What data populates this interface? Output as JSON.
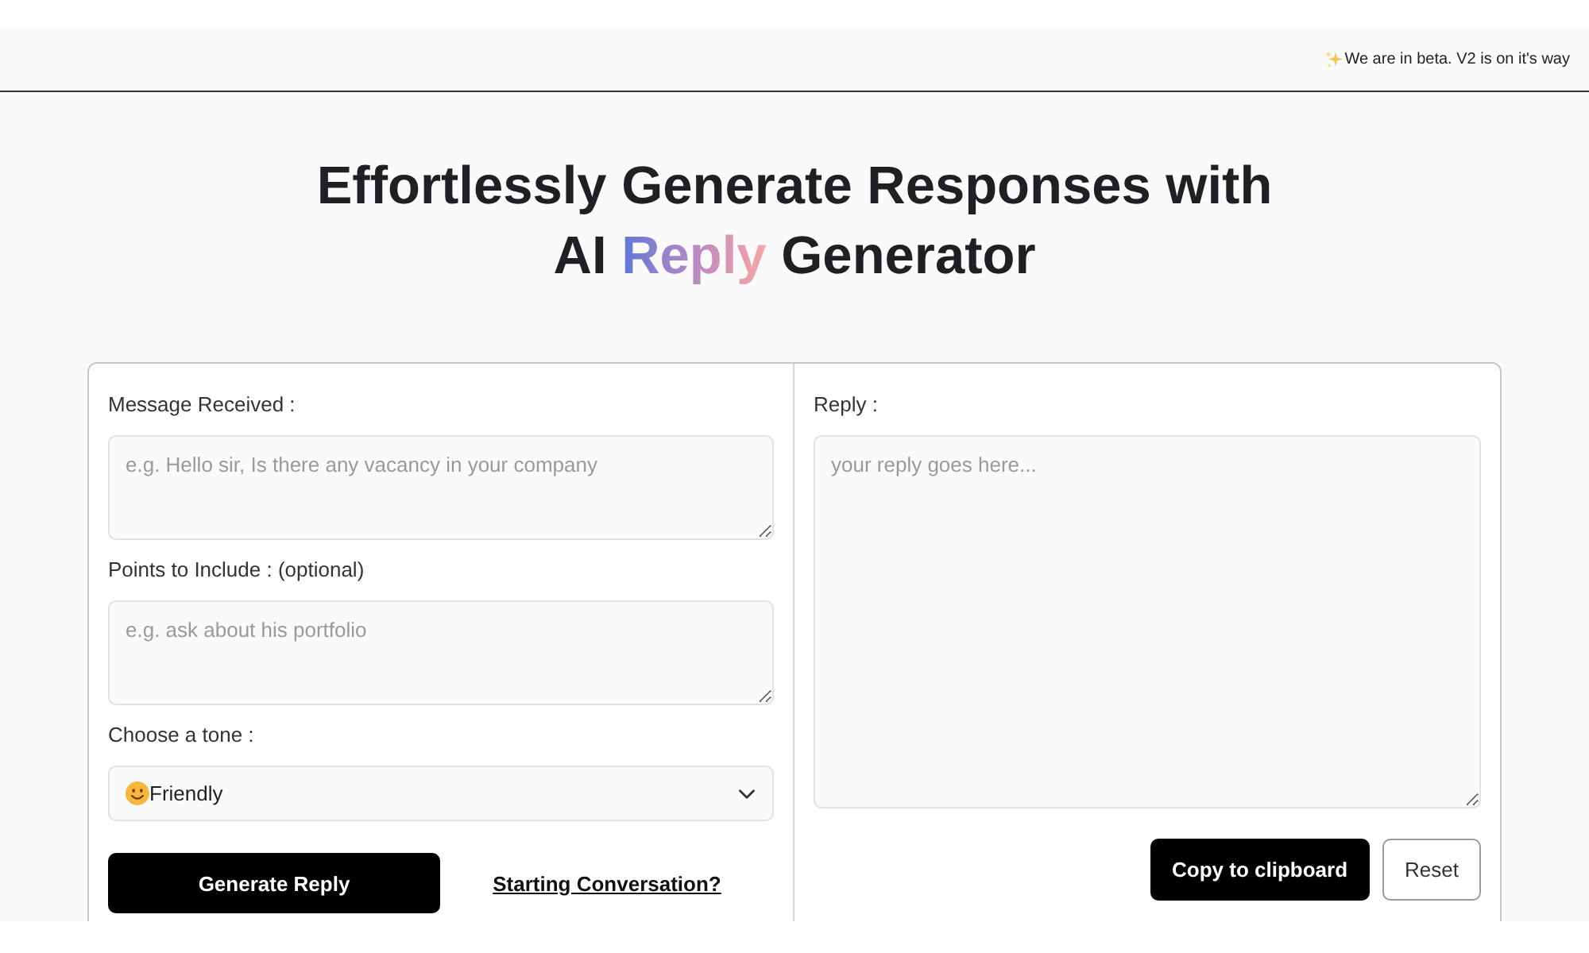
{
  "banner": {
    "text": "We are in beta. V2 is on it's way"
  },
  "heading": {
    "lines": [
      [
        {
          "text": "Effortlessly Generate Responses with",
          "highlight": false
        }
      ],
      [
        {
          "text": "AI",
          "highlight": false
        },
        {
          "text": "Reply",
          "highlight": true
        },
        {
          "text": "Generator",
          "highlight": false
        }
      ]
    ]
  },
  "form": {
    "fields": [
      {
        "kind": "textarea",
        "label": "Message Received :",
        "placeholder": "e.g. Hello sir, Is there any vacancy in your company"
      },
      {
        "kind": "textarea",
        "label": "Points to Include : (optional)",
        "placeholder": "e.g. ask about his portfolio"
      },
      {
        "kind": "select",
        "label": "Choose a tone :",
        "value": "Friendly"
      }
    ],
    "generate_button": "Generate Reply",
    "link": "Starting Conversation?"
  },
  "reply": {
    "label": "Reply :",
    "placeholder": "your reply goes here...",
    "buttons": [
      {
        "kind": "primary",
        "label": "Copy to clipboard"
      },
      {
        "kind": "secondary",
        "label": "Reset"
      }
    ]
  }
}
